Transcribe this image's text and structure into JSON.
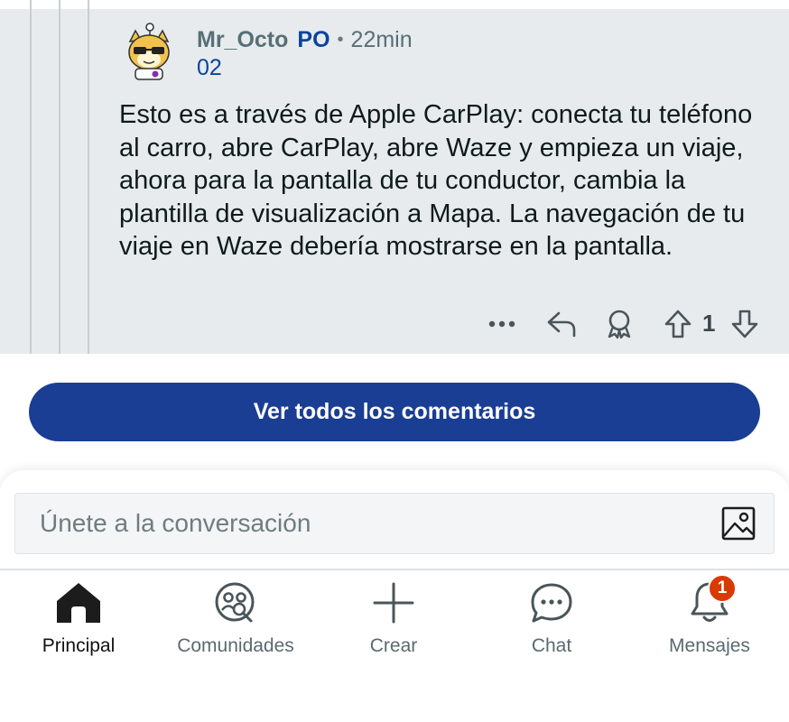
{
  "comment": {
    "author": "Mr_Octo",
    "op_badge": "PO",
    "separator": "•",
    "time": "22min",
    "flair": "02",
    "body": "Esto es a través de Apple CarPlay: conecta tu teléfono al carro, abre CarPlay, abre Waze y empieza un viaje, ahora para la pantalla de tu conductor, cambia la plantilla de visualización a Mapa. La navegación de tu viaje en Waze debería mostrarse en la pantalla.",
    "vote_count": "1",
    "icons": [
      "more-icon",
      "reply-icon",
      "award-icon",
      "upvote-icon",
      "downvote-icon"
    ]
  },
  "view_all": {
    "label": "Ver todos los comentarios"
  },
  "composer": {
    "placeholder": "Únete a la conversación",
    "icon": "image-icon"
  },
  "nav": {
    "items": [
      {
        "label": "Principal",
        "icon": "home-icon",
        "active": true
      },
      {
        "label": "Comunidades",
        "icon": "communities-icon"
      },
      {
        "label": "Crear",
        "icon": "plus-icon"
      },
      {
        "label": "Chat",
        "icon": "chat-icon"
      },
      {
        "label": "Mensajes",
        "icon": "bell-icon",
        "badge": "1"
      }
    ]
  },
  "colors": {
    "comment_bg": "#e7ebee",
    "primary_button": "#1a3e93",
    "op_blue": "#0a449b",
    "badge_red": "#d93a00"
  }
}
